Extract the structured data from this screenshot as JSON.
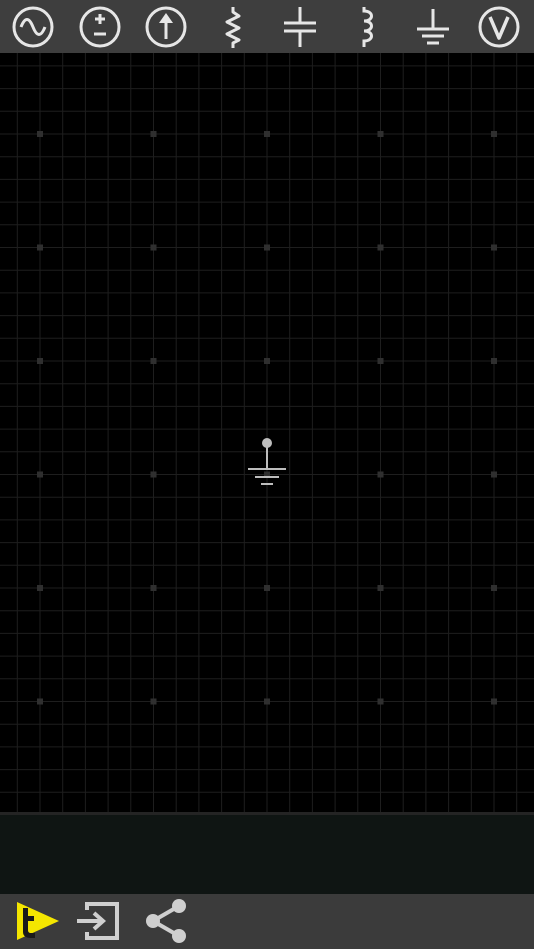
{
  "toolbar": {
    "tools": [
      {
        "name": "ac-source-icon"
      },
      {
        "name": "dc-voltage-source-icon"
      },
      {
        "name": "current-source-icon"
      },
      {
        "name": "resistor-icon"
      },
      {
        "name": "capacitor-icon"
      },
      {
        "name": "inductor-icon"
      },
      {
        "name": "ground-icon"
      },
      {
        "name": "voltmeter-icon"
      }
    ]
  },
  "canvas": {
    "components": [
      {
        "type": "ground",
        "name": "ground-symbol"
      }
    ]
  },
  "bottom_bar": {
    "buttons": [
      {
        "name": "simulate-button",
        "icon": "play-t-icon"
      },
      {
        "name": "export-button",
        "icon": "export-icon"
      },
      {
        "name": "share-button",
        "icon": "share-icon"
      }
    ]
  },
  "colors": {
    "toolbar_bg": "#3e3e3e",
    "icon": "#e6e6e6",
    "canvas_bg": "#000000",
    "grid_line": "#1e1e1e",
    "grid_dot": "#2f2f2f",
    "component": "#bdbdbd",
    "status_bg": "#0f1513",
    "accent_yellow": "#f4e600"
  }
}
